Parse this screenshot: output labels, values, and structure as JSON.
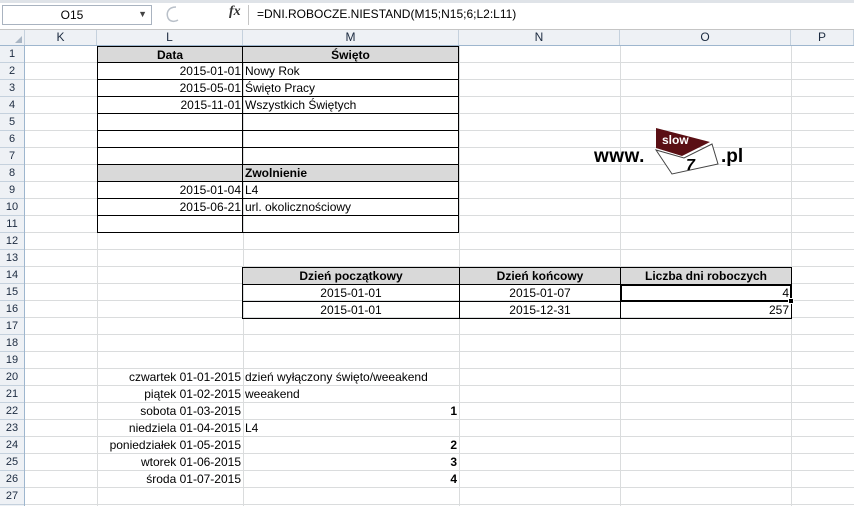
{
  "formula_bar": {
    "name_box": "O15",
    "fx": "fx",
    "formula": "=DNI.ROBOCZE.NIESTAND(M15;N15;6;L2:L11)"
  },
  "columns": [
    "K",
    "L",
    "M",
    "N",
    "O",
    "P"
  ],
  "rows": [
    "1",
    "2",
    "3",
    "4",
    "5",
    "6",
    "7",
    "8",
    "9",
    "10",
    "11",
    "12",
    "13",
    "14",
    "15",
    "16",
    "17",
    "18",
    "19",
    "20",
    "21",
    "22",
    "23",
    "24",
    "25",
    "26",
    "27"
  ],
  "holidays": {
    "header_date": "Data",
    "header_name": "Święto",
    "items": [
      {
        "date": "2015-01-01",
        "name": "Nowy Rok"
      },
      {
        "date": "2015-05-01",
        "name": "Święto Pracy"
      },
      {
        "date": "2015-11-01",
        "name": "Wszystkich Świętych"
      }
    ]
  },
  "leave": {
    "header": "Zwolnienie",
    "items": [
      {
        "date": "2015-01-04",
        "name": "L4"
      },
      {
        "date": "2015-06-21",
        "name": "url. okolicznościowy"
      }
    ]
  },
  "logo": {
    "prefix": "www.",
    "top": "slow",
    "num": "7",
    "suffix": ".pl"
  },
  "workdays": {
    "headers": [
      "Dzień początkowy",
      "Dzień końcowy",
      "Liczba dni roboczych"
    ],
    "rows": [
      [
        "2015-01-01",
        "2015-01-07",
        "4"
      ],
      [
        "2015-01-01",
        "2015-12-31",
        "257"
      ]
    ]
  },
  "calendar": [
    {
      "day": "czwartek 01-01-2015",
      "value": "dzień wyłączony święto/weeakend"
    },
    {
      "day": "piątek 01-02-2015",
      "value": "weeakend"
    },
    {
      "day": "sobota 01-03-2015",
      "value": "1"
    },
    {
      "day": "niedziela 01-04-2015",
      "value": "L4"
    },
    {
      "day": "poniedziałek 01-05-2015",
      "value": "2"
    },
    {
      "day": "wtorek 01-06-2015",
      "value": "3"
    },
    {
      "day": "środa 01-07-2015",
      "value": "4"
    }
  ]
}
